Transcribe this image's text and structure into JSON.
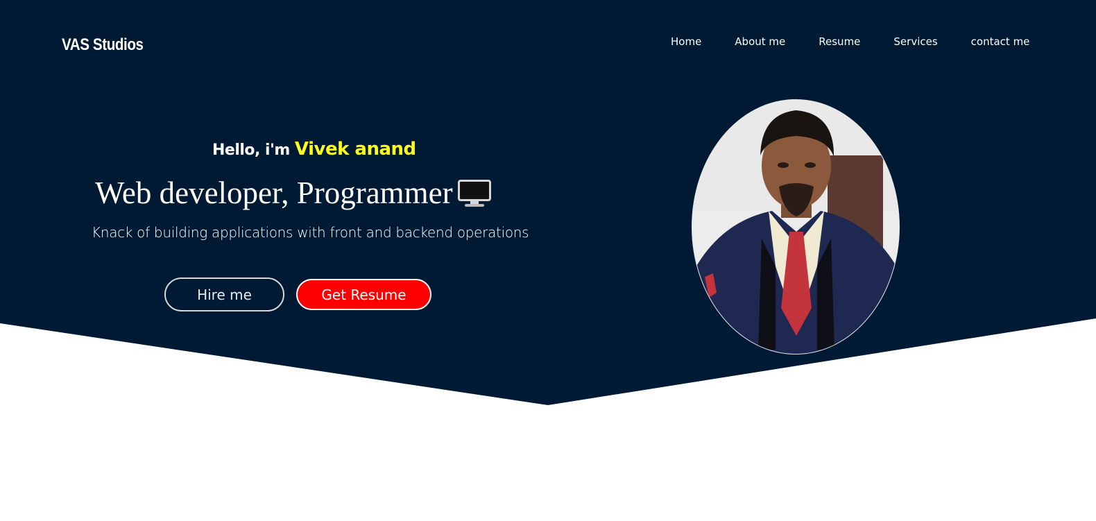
{
  "header": {
    "brand": "VAS Studios",
    "nav": [
      {
        "label": "Home"
      },
      {
        "label": "About me"
      },
      {
        "label": "Resume"
      },
      {
        "label": "Services"
      },
      {
        "label": "contact me"
      }
    ]
  },
  "hero": {
    "greeting": "Hello, i'm",
    "name": "Vivek anand",
    "headline": "Web developer, Programmer",
    "headline_icon": "desktop-computer-icon",
    "subtitle": "Knack of building applications with front and backend operations",
    "buttons": {
      "hire": "Hire me",
      "resume": "Get Resume"
    }
  },
  "colors": {
    "hero_background": "#001a33",
    "name_highlight": "#ffff1a",
    "primary_button": "#ff0000"
  }
}
